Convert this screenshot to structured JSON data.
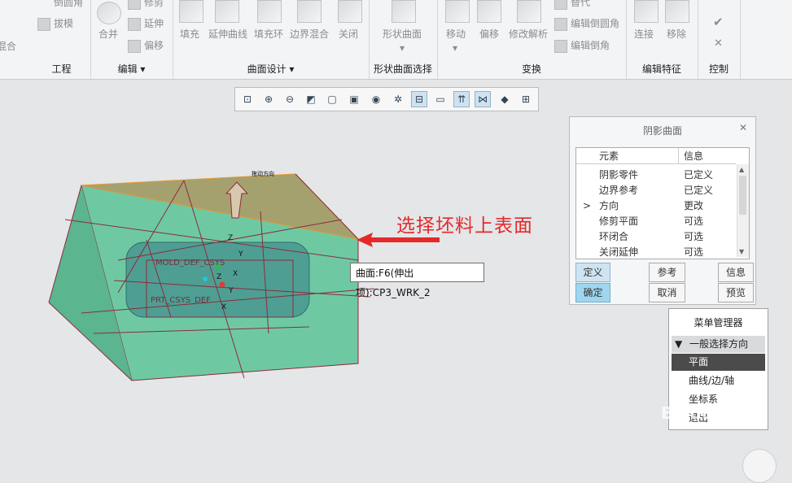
{
  "ribbon": {
    "col0": {
      "item1": "倒圆角",
      "item2": "拔模",
      "item3": "混合"
    },
    "groups": [
      {
        "key": "engineering",
        "label": "工程"
      },
      {
        "key": "edit",
        "label": "编辑 ▾"
      },
      {
        "key": "surface_design",
        "label": "曲面设计 ▾"
      },
      {
        "key": "shape_surface_select",
        "label": "形状曲面选择"
      },
      {
        "key": "transform",
        "label": "变换"
      },
      {
        "key": "edit_feature",
        "label": "编辑特征"
      },
      {
        "key": "control",
        "label": "控制"
      }
    ],
    "edit": {
      "merge": "合并",
      "trim": "修剪",
      "extend": "延伸",
      "offset": "偏移"
    },
    "surface": {
      "fill": "填充",
      "extend_curve": "延伸曲线",
      "fill_ring": "填充环",
      "boundary_blend": "边界混合",
      "close": "关闭"
    },
    "shape": {
      "shape_surface": "形状曲面"
    },
    "transform": {
      "move": "移动",
      "offset": "偏移",
      "modify_analysis": "修改解析",
      "replace": "替代",
      "edit_round": "编辑倒圆角",
      "edit_chamfer": "编辑倒角"
    },
    "edit_feature": {
      "connect": "连接",
      "remove": "移除"
    },
    "control": {
      "check": "✔",
      "close": "✕"
    }
  },
  "view_toolbar": {
    "icons": [
      "⊡",
      "⊕",
      "⊖",
      "◩",
      "▢",
      "▣",
      "◉",
      "✲",
      "⊟",
      "▭",
      "⇈",
      "⋈",
      "◆",
      "⊞"
    ]
  },
  "dialog": {
    "title": "阴影曲面",
    "columns": {
      "element": "元素",
      "info": "信息"
    },
    "rows": [
      {
        "marker": "",
        "element": "阴影零件",
        "info": "已定义"
      },
      {
        "marker": "",
        "element": "边界参考",
        "info": "已定义"
      },
      {
        "marker": ">",
        "element": "方向",
        "info": "更改"
      },
      {
        "marker": "",
        "element": "修剪平面",
        "info": "可选"
      },
      {
        "marker": "",
        "element": "环闭合",
        "info": "可选"
      },
      {
        "marker": "",
        "element": "关闭延伸",
        "info": "可选"
      }
    ],
    "buttons": {
      "define": "定义",
      "reference": "参考",
      "info": "信息",
      "ok": "确定",
      "cancel": "取消",
      "preview": "预览"
    }
  },
  "menu_manager": {
    "title": "菜单管理器",
    "section": "一般选择方向",
    "items": [
      {
        "label": "平面",
        "selected": true
      },
      {
        "label": "曲线/边/轴",
        "selected": false
      },
      {
        "label": "坐标系",
        "selected": false
      },
      {
        "label": "退出",
        "selected": false
      }
    ]
  },
  "tooltip": "曲面:F6(伸出项):CP3_WRK_2",
  "annotation": "选择坯料上表面",
  "model_labels": {
    "top": "拖动方向",
    "mold": "MOLD_DEF_CSYS",
    "prt": "PRT_CSYS_DEF",
    "axes": [
      "Z",
      "Y",
      "X",
      "Z",
      "Y",
      "X"
    ]
  },
  "watermark": "Baidu 经验",
  "colors": {
    "block": "#6ec9a3",
    "top_face": "#a39f6a",
    "edges": "#8b2c3a",
    "annotation": "#e5292a",
    "highlight": "#f39a2c"
  }
}
